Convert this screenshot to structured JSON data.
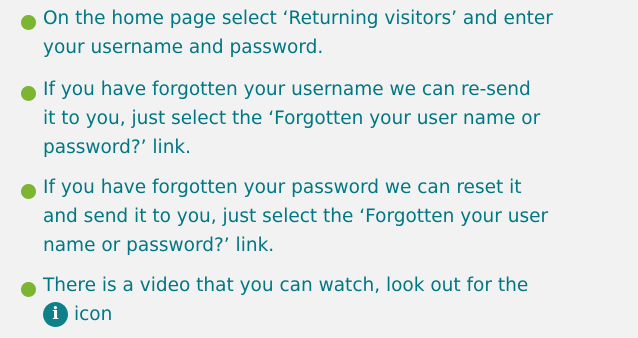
{
  "instructions": [
    {
      "lines": [
        "On the home page select ‘Returning visitors’ and enter",
        "your username and password."
      ]
    },
    {
      "lines": [
        "If you have forgotten your username we can re-send",
        "it to you, just select the ‘Forgotten your user name or",
        "password?’ link."
      ]
    },
    {
      "lines": [
        "If you have forgotten your password we can reset it",
        "and send it to you, just select the ‘Forgotten your user",
        "name or password?’ link."
      ]
    },
    {
      "lines": [
        "There is a video that you can watch, look out for the",
        "icon"
      ],
      "icon_glyph": "i",
      "icon_name": "info-icon"
    }
  ],
  "colors": {
    "text": "#007782",
    "bullet": "#7bb531",
    "info_icon_bg": "#0f7f89",
    "background": "#f2f2f2"
  }
}
